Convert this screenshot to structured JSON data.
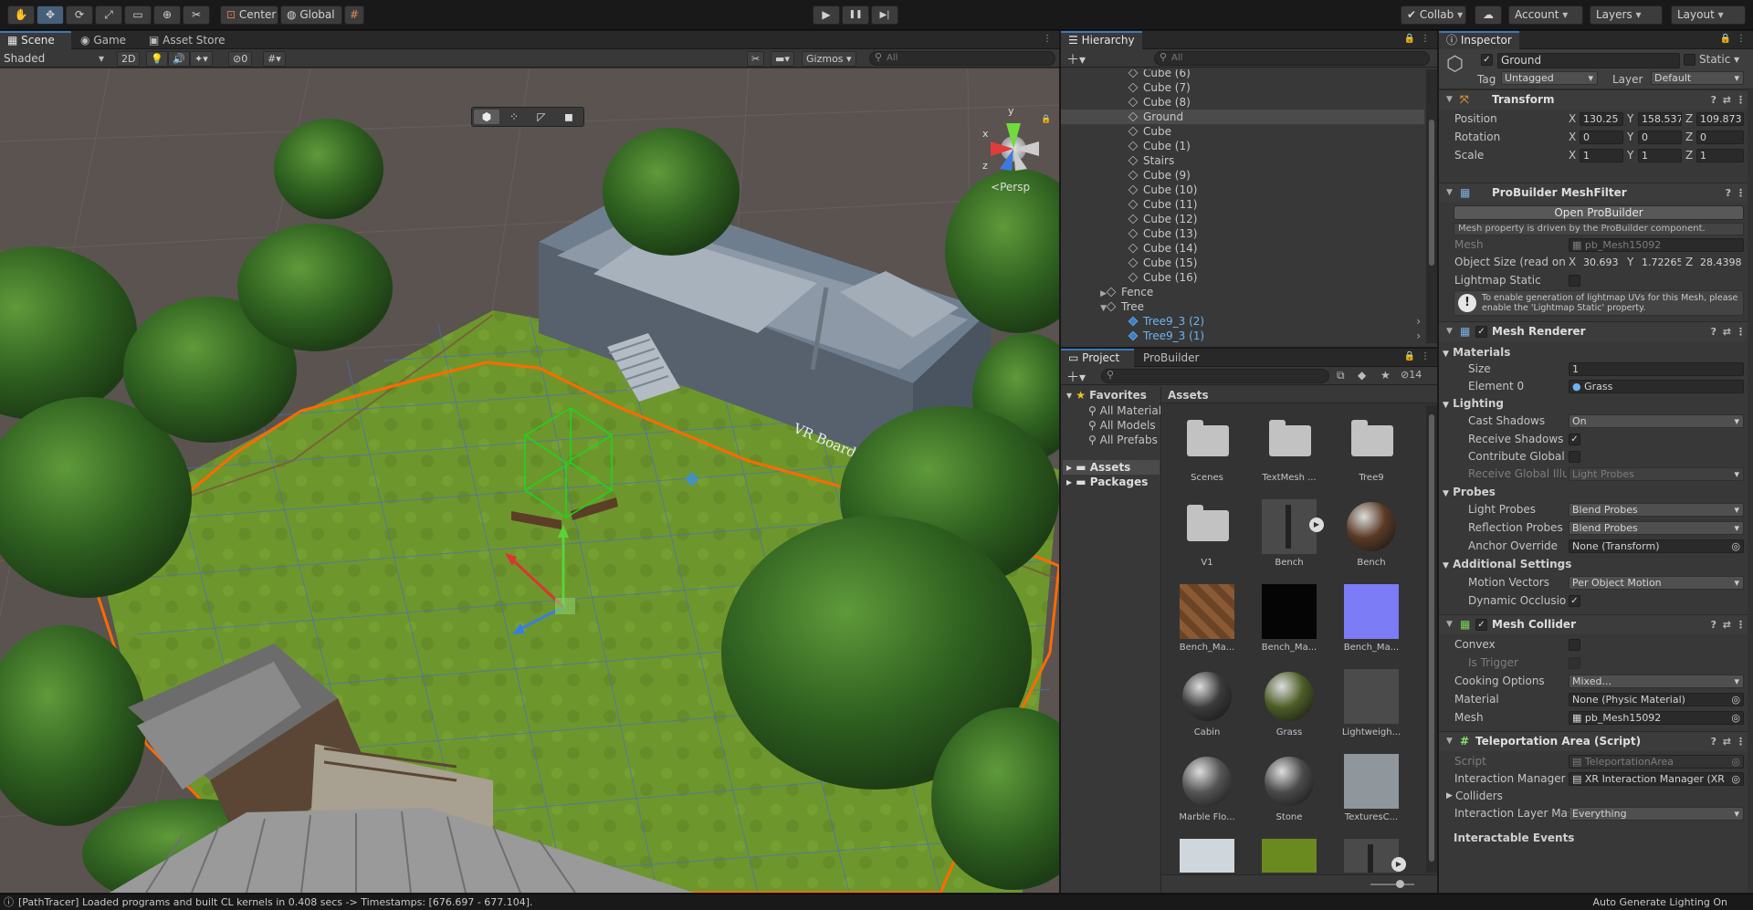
{
  "toolbar": {
    "tools": [
      {
        "name": "hand-tool",
        "icon": "✋",
        "active": false
      },
      {
        "name": "move-tool",
        "icon": "✥",
        "active": true
      },
      {
        "name": "rotate-tool",
        "icon": "⟳",
        "active": false
      },
      {
        "name": "scale-tool",
        "icon": "⤢",
        "active": false
      },
      {
        "name": "rect-tool",
        "icon": "▭",
        "active": false
      },
      {
        "name": "transform-tool",
        "icon": "⊕",
        "active": false
      },
      {
        "name": "custom-tool",
        "icon": "✂",
        "active": false
      }
    ],
    "pivot": "Center",
    "space": "Global",
    "grid_icon": "#",
    "play": "▶",
    "pause": "❚❚",
    "step": "▶|",
    "collab": "Collab",
    "account": "Account",
    "layers": "Layers",
    "layout": "Layout"
  },
  "scene_view": {
    "tabs": [
      "Scene",
      "Game",
      "Asset Store"
    ],
    "shading": "Shaded",
    "mode_2d": "2D",
    "gizmos": "Gizmos",
    "search_placeholder": "All",
    "hidden_count": "0",
    "persp": "Persp",
    "board_label": "VR Board Room",
    "axis": {
      "x": "x",
      "y": "y",
      "z": "z"
    }
  },
  "hierarchy": {
    "title": "Hierarchy",
    "search_placeholder": "All",
    "items": [
      {
        "label": "Cube (6)",
        "depth": 0,
        "kind": "cube"
      },
      {
        "label": "Cube (7)",
        "depth": 0,
        "kind": "cube"
      },
      {
        "label": "Cube (8)",
        "depth": 0,
        "kind": "cube"
      },
      {
        "label": "Ground",
        "depth": 0,
        "kind": "cube",
        "selected": true
      },
      {
        "label": "Cube",
        "depth": 0,
        "kind": "cube"
      },
      {
        "label": "Cube (1)",
        "depth": 0,
        "kind": "cube"
      },
      {
        "label": "Stairs",
        "depth": 0,
        "kind": "cube"
      },
      {
        "label": "Cube (9)",
        "depth": 0,
        "kind": "cube"
      },
      {
        "label": "Cube (10)",
        "depth": 0,
        "kind": "cube"
      },
      {
        "label": "Cube (11)",
        "depth": 0,
        "kind": "cube"
      },
      {
        "label": "Cube (12)",
        "depth": 0,
        "kind": "cube"
      },
      {
        "label": "Cube (13)",
        "depth": 0,
        "kind": "cube"
      },
      {
        "label": "Cube (14)",
        "depth": 0,
        "kind": "cube"
      },
      {
        "label": "Cube (15)",
        "depth": 0,
        "kind": "cube"
      },
      {
        "label": "Cube (16)",
        "depth": 0,
        "kind": "cube"
      },
      {
        "label": "Fence",
        "depth": -1,
        "kind": "collapsed"
      },
      {
        "label": "Tree",
        "depth": -1,
        "kind": "expanded"
      },
      {
        "label": "Tree9_3 (2)",
        "depth": 0,
        "kind": "prefab"
      },
      {
        "label": "Tree9_3 (1)",
        "depth": 0,
        "kind": "prefab"
      }
    ]
  },
  "project": {
    "tabs": [
      "Project",
      "ProBuilder"
    ],
    "hidden_count": "14",
    "favorites_label": "Favorites",
    "favorites": [
      "All Materials",
      "All Models",
      "All Prefabs"
    ],
    "roots": [
      "Assets",
      "Packages"
    ],
    "breadcrumb": "Assets",
    "assets": [
      {
        "name": "Scenes",
        "kind": "folder"
      },
      {
        "name": "TextMesh ...",
        "kind": "folder"
      },
      {
        "name": "Tree9",
        "kind": "folder"
      },
      {
        "name": "V1",
        "kind": "folder"
      },
      {
        "name": "Bench",
        "kind": "model"
      },
      {
        "name": "Bench",
        "kind": "sphere",
        "color": "#5a3a26"
      },
      {
        "name": "Bench_Ma...",
        "kind": "wood"
      },
      {
        "name": "Bench_Ma...",
        "kind": "square",
        "color": "#050505"
      },
      {
        "name": "Bench_Ma...",
        "kind": "square",
        "color": "#7c7cf6"
      },
      {
        "name": "Cabin",
        "kind": "sphere",
        "color": "#3b3b3b"
      },
      {
        "name": "Grass",
        "kind": "sphere",
        "color": "#4d5d26"
      },
      {
        "name": "Lightweigh...",
        "kind": "square",
        "color": "#4b4b4b"
      },
      {
        "name": "Marble Flo...",
        "kind": "sphere",
        "color": "#555"
      },
      {
        "name": "Stone",
        "kind": "sphere",
        "color": "#4a4a4a"
      },
      {
        "name": "TexturesC...",
        "kind": "square",
        "color": "#8f969c"
      },
      {
        "name": "",
        "kind": "square",
        "color": "#cfd6dc"
      },
      {
        "name": "",
        "kind": "square",
        "color": "#6a8a1f"
      },
      {
        "name": "",
        "kind": "model2"
      }
    ]
  },
  "inspector": {
    "title": "Inspector",
    "object_name": "Ground",
    "static_label": "Static",
    "tag_label": "Tag",
    "tag": "Untagged",
    "layer_label": "Layer",
    "layer": "Default",
    "transform": {
      "title": "Transform",
      "position_label": "Position",
      "position": [
        "130.25",
        "158.537",
        "109.873"
      ],
      "rotation_label": "Rotation",
      "rotation": [
        "0",
        "0",
        "0"
      ],
      "scale_label": "Scale",
      "scale": [
        "1",
        "1",
        "1"
      ]
    },
    "meshfilter": {
      "title": "ProBuilder MeshFilter",
      "open_button": "Open ProBuilder",
      "note": "Mesh property is driven by the ProBuilder component.",
      "mesh_label": "Mesh",
      "mesh": "pb_Mesh15092",
      "size_label": "Object Size (read only)",
      "size": [
        "30.693",
        "1.72265",
        "28.4398"
      ],
      "lightmap_label": "Lightmap Static",
      "warning": "To enable generation of lightmap UVs for this Mesh, please enable the 'Lightmap Static' property."
    },
    "renderer": {
      "title": "Mesh Renderer",
      "materials": "Materials",
      "size_label": "Size",
      "size": "1",
      "element_label": "Element 0",
      "element": "Grass",
      "lighting": "Lighting",
      "cast_label": "Cast Shadows",
      "cast": "On",
      "receive_label": "Receive Shadows",
      "contribute_label": "Contribute Global Illumination",
      "receive_gi_label": "Receive Global Illumination",
      "receive_gi": "Light Probes",
      "probes": "Probes",
      "light_probes_label": "Light Probes",
      "light_probes": "Blend Probes",
      "reflection_label": "Reflection Probes",
      "reflection": "Blend Probes",
      "anchor_label": "Anchor Override",
      "anchor": "None (Transform)",
      "additional": "Additional Settings",
      "motion_label": "Motion Vectors",
      "motion": "Per Object Motion",
      "dynamic_label": "Dynamic Occlusion"
    },
    "collider": {
      "title": "Mesh Collider",
      "convex_label": "Convex",
      "trigger_label": "Is Trigger",
      "cooking_label": "Cooking Options",
      "cooking": "Mixed...",
      "material_label": "Material",
      "material": "None (Physic Material)",
      "mesh_label": "Mesh",
      "mesh": "pb_Mesh15092"
    },
    "teleport": {
      "title": "Teleportation Area (Script)",
      "script_label": "Script",
      "script": "TeleportationArea",
      "manager_label": "Interaction Manager",
      "manager": "XR Interaction Manager (XR",
      "colliders_label": "Colliders",
      "layer_label": "Interaction Layer Mask",
      "layer": "Everything",
      "events_label": "Interactable Events"
    }
  },
  "status": {
    "message": "[PathTracer] Loaded programs and built CL kernels in 0.408 secs -> Timestamps: [676.697 - 677.104].",
    "lighting": "Auto Generate Lighting On"
  },
  "colors": {
    "accent": "#3a79bb",
    "selection_outline": "#ff6a00",
    "grass": "#6f9a2e",
    "building": "#6b7a8a"
  }
}
